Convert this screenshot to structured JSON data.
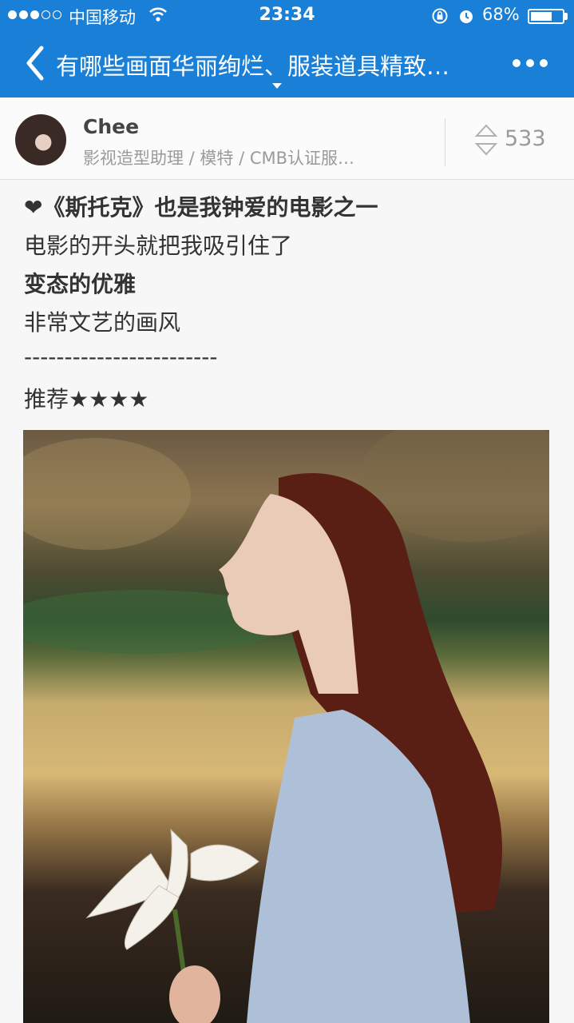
{
  "status_bar": {
    "carrier": "中国移动",
    "time": "23:34",
    "battery_percent": "68%",
    "battery_level": 0.68,
    "signal_bars_filled": 3,
    "signal_bars_total": 5
  },
  "nav": {
    "title": "有哪些画面华丽绚烂、服装道具精致…",
    "back_icon": "chevron-left-icon",
    "more_icon": "more-dots-icon"
  },
  "author": {
    "name": "Chee",
    "bio": "影视造型助理 / 模特 / CMB认证服…",
    "votes": "533"
  },
  "answer": {
    "lines": [
      "❤《斯托克》也是我钟爱的电影之一",
      "电影的开头就把我吸引住了",
      "变态的优雅",
      "非常文艺的画风",
      "------------------------",
      "推荐★★★★"
    ]
  },
  "colors": {
    "nav_blue": "#1a7fd6",
    "background": "#f7f7f7",
    "muted_text": "#9a9a9a"
  }
}
